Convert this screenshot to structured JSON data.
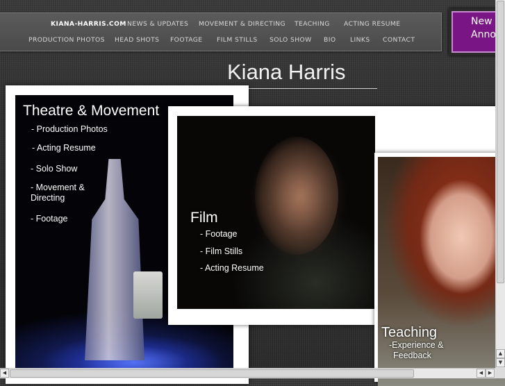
{
  "nav": {
    "row1": [
      {
        "label": "KIANA-HARRIS.COM"
      },
      {
        "label": "NEWS & UPDATES"
      },
      {
        "label": "MOVEMENT & DIRECTING"
      },
      {
        "label": "TEACHING"
      },
      {
        "label": "ACTING RESUME"
      }
    ],
    "row2": [
      {
        "label": "PRODUCTION PHOTOS"
      },
      {
        "label": "HEAD SHOTS"
      },
      {
        "label": "FOOTAGE"
      },
      {
        "label": "FILM STILLS"
      },
      {
        "label": "SOLO SHOW"
      },
      {
        "label": "BIO"
      },
      {
        "label": "LINKS"
      },
      {
        "label": "CONTACT"
      }
    ]
  },
  "announcement": {
    "line1": "New",
    "line2": "Anno"
  },
  "site_title": "Kiana Harris",
  "theatre": {
    "heading": "Theatre & Movement",
    "links": [
      "- Production Photos",
      "- Acting Resume",
      "- Solo Show",
      "- Movement &",
      "Directing",
      "- Footage"
    ]
  },
  "film": {
    "heading": "Film",
    "links": [
      "- Footage",
      "- Film Stills",
      "- Acting Resume"
    ]
  },
  "teaching": {
    "heading": "Teaching",
    "links": [
      "-Experience &",
      "Feedback"
    ]
  },
  "colors": {
    "announcement_bg": "#7a1585",
    "nav_bg": "#4f4f4f",
    "page_bg": "#333333"
  }
}
